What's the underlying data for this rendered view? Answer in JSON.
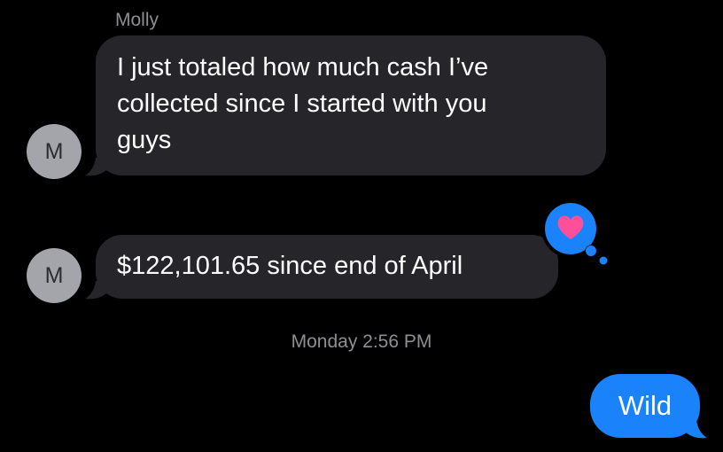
{
  "conversation": {
    "sender_name": "Molly",
    "avatar_initial": "M",
    "messages": [
      {
        "from": "them",
        "lines": [
          "I just totaled how much cash I’ve",
          "collected since I started with you",
          "guys"
        ]
      },
      {
        "from": "them",
        "text": "$122,101.65 since end of April",
        "reaction": "heart"
      }
    ],
    "timestamp": "Monday 2:56 PM",
    "outgoing": {
      "from": "me",
      "text": "Wild"
    }
  },
  "colors": {
    "background": "#000000",
    "incoming_bubble": "#26262a",
    "outgoing_bubble": "#1a82fb",
    "avatar": "#a3a5ab",
    "meta_text": "#8e8e93",
    "heart": "#ff4f9a",
    "tapback_bg": "#1a82fb"
  },
  "icons": {
    "reaction": "heart-icon"
  }
}
